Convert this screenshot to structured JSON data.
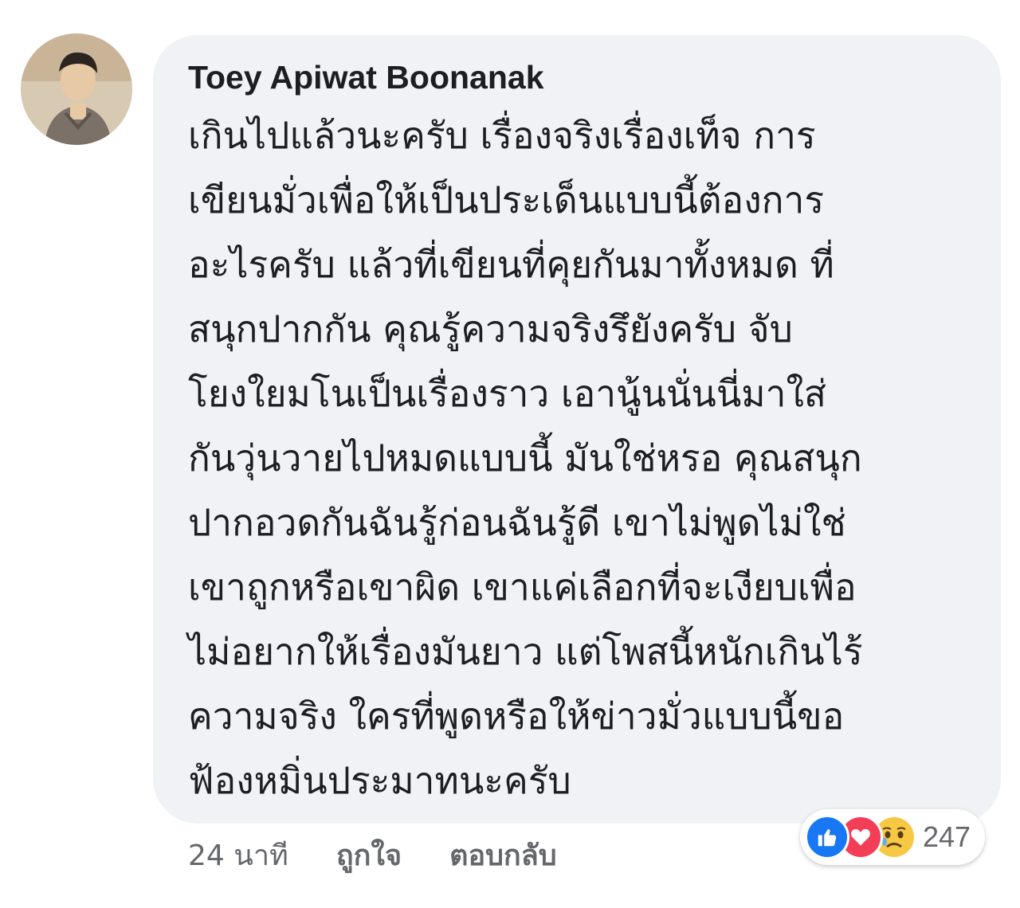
{
  "comment": {
    "author": "Toey Apiwat Boonanak",
    "lines": [
      "เกินไปแล้วนะครับ เรื่องจริงเรื่องเท็จ การ",
      "เขียนมั่วเพื่อให้เป็นประเด็นแบบนี้ต้องการ",
      "อะไรครับ แล้วที่เขียนที่คุยกันมาทั้งหมด ที่",
      "สนุกปากกัน คุณรู้ความจริงรึยังครับ จับ",
      "โยงใยมโนเป็นเรื่องราว เอานู้นนั่นนี่มาใส่",
      "กันวุ่นวายไปหมดแบบนี้ มันใช่หรอ คุณสนุก",
      "ปากอวดกันฉันรู้ก่อนฉันรู้ดี เขาไม่พูดไม่ใช่",
      "เขาถูกหรือเขาผิด เขาแค่เลือกที่จะเงียบเพื่อ",
      "ไม่อยากให้เรื่องมันยาว แต่โพสนี้หนักเกินไร้",
      "ความจริง ใครที่พูดหรือให้ข่าวมั่วแบบนี้ขอ",
      "ฟ้องหมิ่นประมาทนะครับ"
    ]
  },
  "actions": {
    "time": "24 นาที",
    "like": "ถูกใจ",
    "reply": "ตอบกลับ"
  },
  "reactions": {
    "icons": [
      "thumbs-up-icon",
      "heart-icon",
      "sad-face-icon"
    ],
    "count": "247"
  },
  "colors": {
    "bubble": "#f0f2f5",
    "text": "#1c1e21",
    "muted": "#65676b",
    "like": "#1877f2",
    "love": "#f33e58",
    "sad": "#f7c844"
  }
}
